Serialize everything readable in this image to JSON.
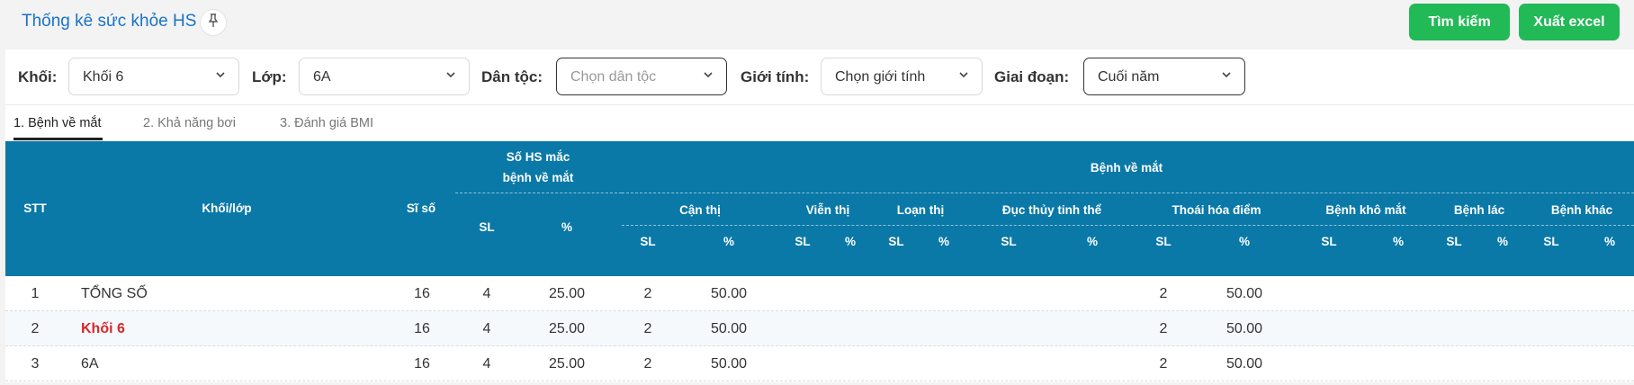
{
  "header": {
    "title": "Thống kê sức khỏe HS",
    "pin_icon": "pin-icon",
    "search_label": "Tìm kiếm",
    "excel_label": "Xuất excel",
    "accent_color": "#22b957",
    "title_color": "#1a73c8"
  },
  "filters": {
    "khoi_label": "Khối:",
    "khoi_value": "Khối 6",
    "lop_label": "Lớp:",
    "lop_value": "6A",
    "dantoc_label": "Dân tộc:",
    "dantoc_placeholder": "Chọn dân tộc",
    "gioitinh_label": "Giới tính:",
    "gioitinh_placeholder": "Chọn giới tính",
    "giaidoan_label": "Giai đoạn:",
    "giaidoan_value": "Cuối năm",
    "chevron_icon": "chevron-down-icon"
  },
  "tabs": [
    "1. Bệnh về mắt",
    "2. Khả năng bơi",
    "3. Đánh giá BMI"
  ],
  "table": {
    "header_color": "#0a79a8",
    "headers": {
      "stt": "STT",
      "khoi_lop": "Khối/lớp",
      "si_so": "Sĩ số",
      "so_hs_line1": "Số HS mắc",
      "so_hs_line2": "bệnh về mắt",
      "benh_ve_mat": "Bệnh về mắt",
      "sl": "SL",
      "pct": "%",
      "groups": [
        "Cận thị",
        "Viễn thị",
        "Loạn thị",
        "Đục thủy tinh thể",
        "Thoái hóa điểm",
        "Bệnh khô mắt",
        "Bệnh lác",
        "Bệnh khác"
      ]
    },
    "rows": [
      {
        "stt": "1",
        "name": "TỔNG SỐ",
        "si_so": "16",
        "sl": "4",
        "pct": "25.00",
        "can_sl": "2",
        "can_pct": "50.00",
        "thoai_sl": "2",
        "thoai_pct": "50.00"
      },
      {
        "stt": "2",
        "name": "Khối 6",
        "si_so": "16",
        "sl": "4",
        "pct": "25.00",
        "can_sl": "2",
        "can_pct": "50.00",
        "thoai_sl": "2",
        "thoai_pct": "50.00"
      },
      {
        "stt": "3",
        "name": "6A",
        "si_so": "16",
        "sl": "4",
        "pct": "25.00",
        "can_sl": "2",
        "can_pct": "50.00",
        "thoai_sl": "2",
        "thoai_pct": "50.00"
      }
    ]
  }
}
